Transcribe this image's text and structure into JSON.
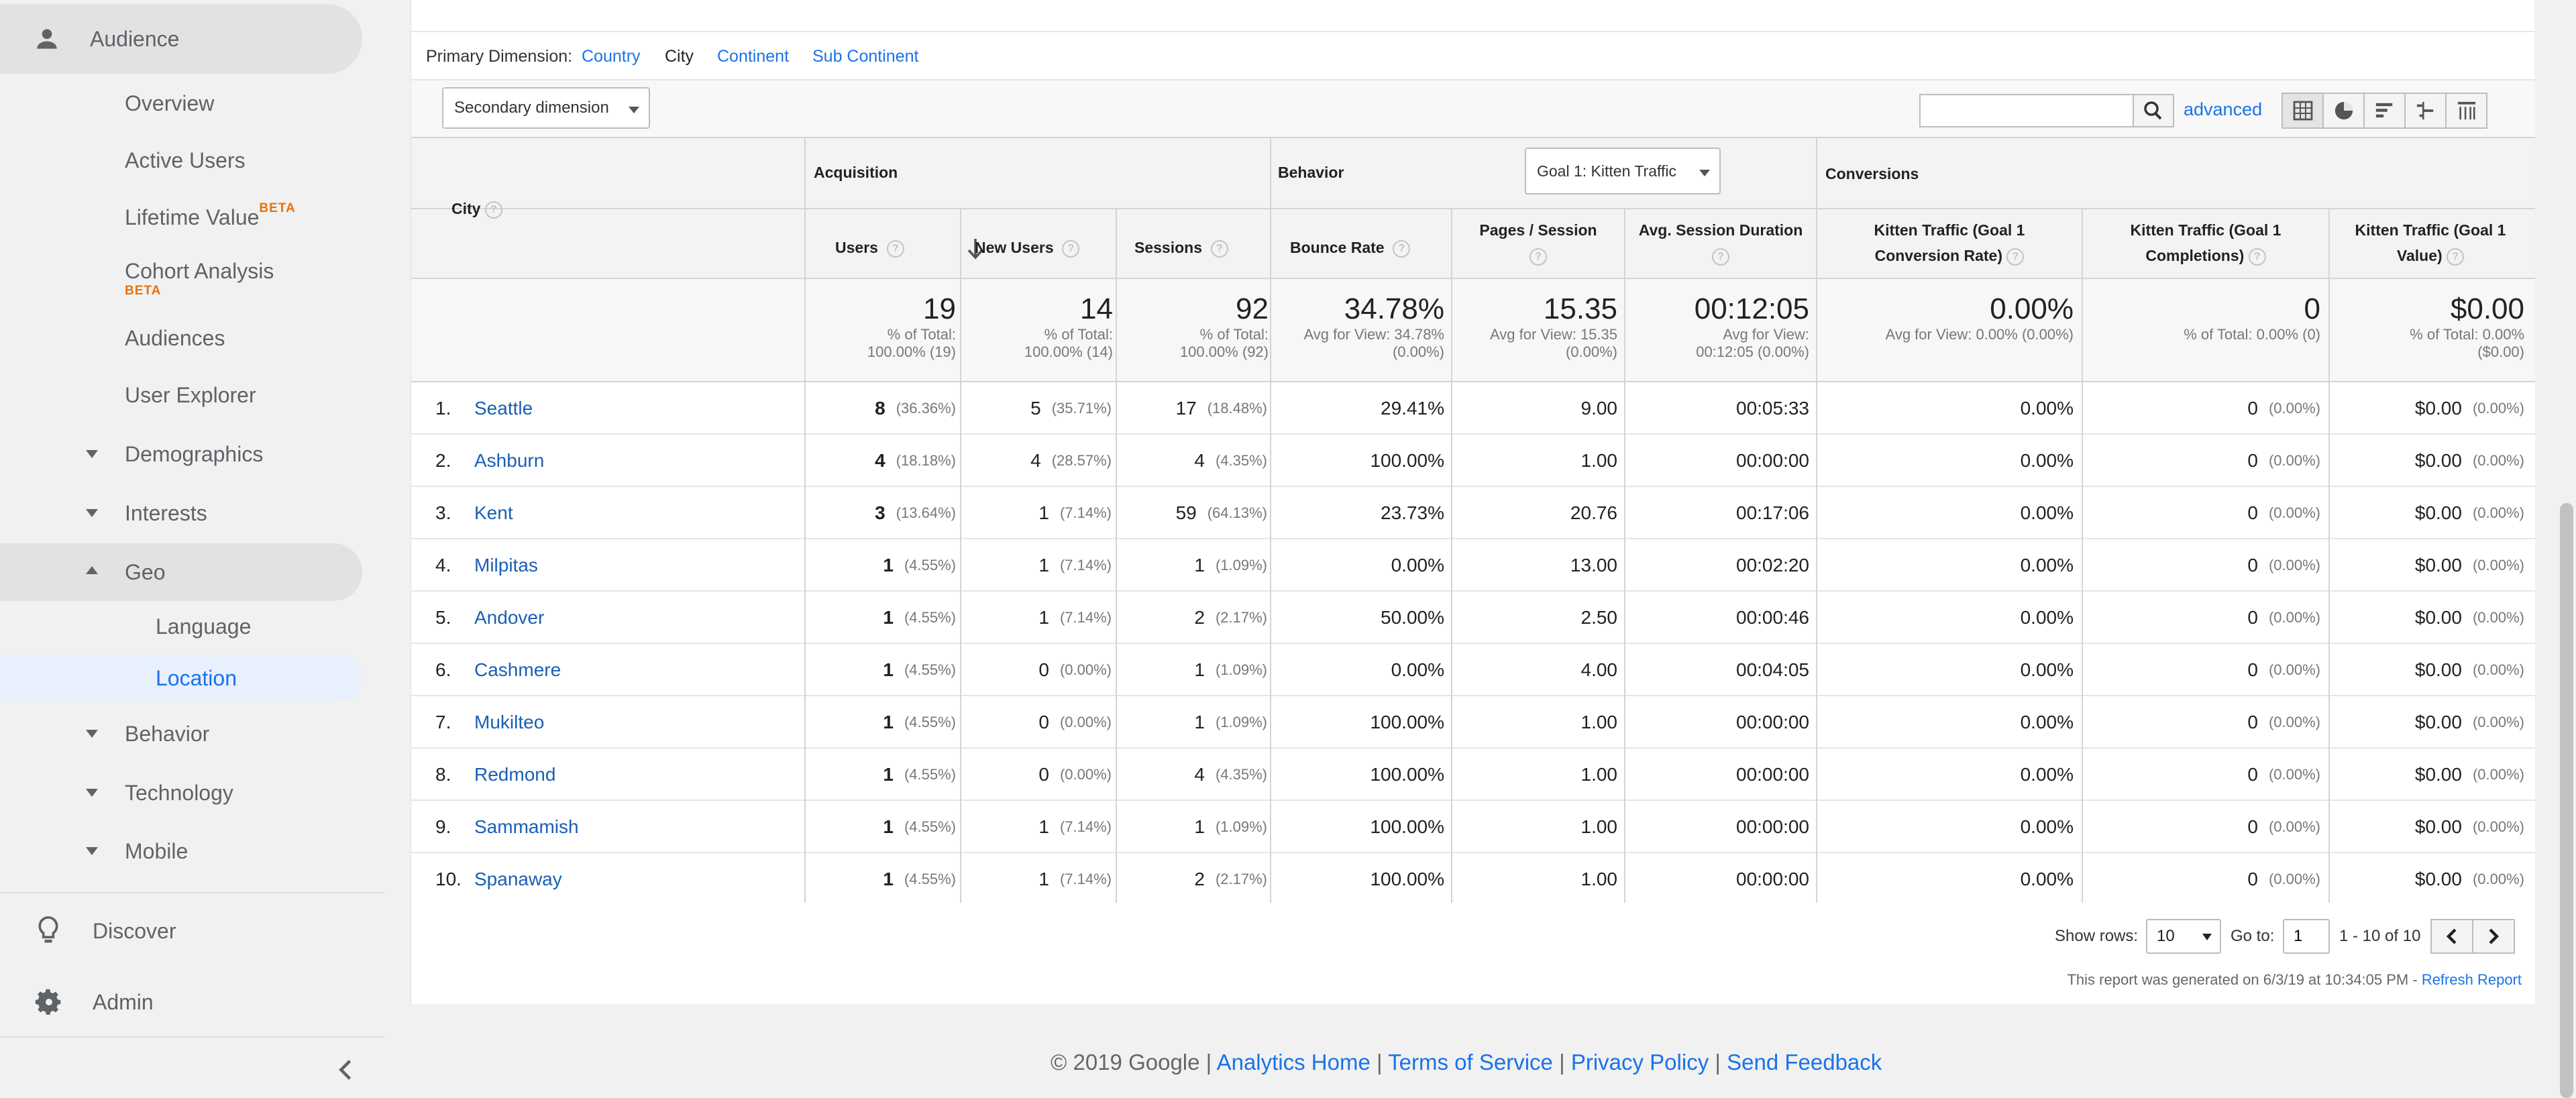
{
  "sidebar": {
    "audience": "Audience",
    "items": [
      {
        "label": "Overview"
      },
      {
        "label": "Active Users"
      },
      {
        "label": "Lifetime Value",
        "badge": "BETA"
      },
      {
        "label": "Cohort Analysis",
        "badge": "BETA"
      },
      {
        "label": "Audiences"
      },
      {
        "label": "User Explorer"
      }
    ],
    "demographics": "Demographics",
    "interests": "Interests",
    "geo": "Geo",
    "language": "Language",
    "location": "Location",
    "behavior": "Behavior",
    "technology": "Technology",
    "mobile": "Mobile",
    "discover": "Discover",
    "admin": "Admin"
  },
  "primary_dimension": {
    "label": "Primary Dimension:",
    "options": [
      "Country",
      "City",
      "Continent",
      "Sub Continent"
    ],
    "selected": "City"
  },
  "toolbar": {
    "secondary_dimension": "Secondary dimension",
    "search_value": "",
    "advanced": "advanced"
  },
  "table": {
    "dimension_header": "City",
    "groups": {
      "acquisition": "Acquisition",
      "behavior": "Behavior",
      "conversions": "Conversions"
    },
    "goal_select": "Goal 1: Kitten Traffic",
    "columns": {
      "users": "Users",
      "new_users": "New Users",
      "sessions": "Sessions",
      "bounce_rate": "Bounce Rate",
      "pages_session": "Pages / Session",
      "avg_duration": "Avg. Session Duration",
      "conv_rate_1": "Kitten Traffic (Goal 1",
      "conv_rate_2": "Conversion Rate)",
      "completions_1": "Kitten Traffic (Goal 1",
      "completions_2": "Completions)",
      "value_1": "Kitten Traffic (Goal 1",
      "value_2": "Value)"
    },
    "totals": {
      "users": {
        "big": "19",
        "l1": "% of Total:",
        "l2": "100.00% (19)"
      },
      "new_users": {
        "big": "14",
        "l1": "% of Total:",
        "l2": "100.00% (14)"
      },
      "sessions": {
        "big": "92",
        "l1": "% of Total:",
        "l2": "100.00% (92)"
      },
      "bounce_rate": {
        "big": "34.78%",
        "l1": "Avg for View: 34.78%",
        "l2": "(0.00%)"
      },
      "pages_session": {
        "big": "15.35",
        "l1": "Avg for View: 15.35",
        "l2": "(0.00%)"
      },
      "avg_duration": {
        "big": "00:12:05",
        "l1": "Avg for View:",
        "l2": "00:12:05 (0.00%)"
      },
      "conv_rate": {
        "big": "0.00%",
        "l1": "Avg for View: 0.00% (0.00%)",
        "l2": ""
      },
      "completions": {
        "big": "0",
        "l1": "% of Total: 0.00% (0)",
        "l2": ""
      },
      "value": {
        "big": "$0.00",
        "l1": "% of Total: 0.00%",
        "l2": "($0.00)"
      }
    },
    "rows": [
      {
        "n": "1.",
        "city": "Seattle",
        "users": "8",
        "users_pct": "(36.36%)",
        "new_users": "5",
        "new_users_pct": "(35.71%)",
        "sessions": "17",
        "sessions_pct": "(18.48%)",
        "bounce": "29.41%",
        "pps": "9.00",
        "dur": "00:05:33",
        "conv": "0.00%",
        "comp": "0",
        "comp_pct": "(0.00%)",
        "val": "$0.00",
        "val_pct": "(0.00%)"
      },
      {
        "n": "2.",
        "city": "Ashburn",
        "users": "4",
        "users_pct": "(18.18%)",
        "new_users": "4",
        "new_users_pct": "(28.57%)",
        "sessions": "4",
        "sessions_pct": "(4.35%)",
        "bounce": "100.00%",
        "pps": "1.00",
        "dur": "00:00:00",
        "conv": "0.00%",
        "comp": "0",
        "comp_pct": "(0.00%)",
        "val": "$0.00",
        "val_pct": "(0.00%)"
      },
      {
        "n": "3.",
        "city": "Kent",
        "users": "3",
        "users_pct": "(13.64%)",
        "new_users": "1",
        "new_users_pct": "(7.14%)",
        "sessions": "59",
        "sessions_pct": "(64.13%)",
        "bounce": "23.73%",
        "pps": "20.76",
        "dur": "00:17:06",
        "conv": "0.00%",
        "comp": "0",
        "comp_pct": "(0.00%)",
        "val": "$0.00",
        "val_pct": "(0.00%)"
      },
      {
        "n": "4.",
        "city": "Milpitas",
        "users": "1",
        "users_pct": "(4.55%)",
        "new_users": "1",
        "new_users_pct": "(7.14%)",
        "sessions": "1",
        "sessions_pct": "(1.09%)",
        "bounce": "0.00%",
        "pps": "13.00",
        "dur": "00:02:20",
        "conv": "0.00%",
        "comp": "0",
        "comp_pct": "(0.00%)",
        "val": "$0.00",
        "val_pct": "(0.00%)"
      },
      {
        "n": "5.",
        "city": "Andover",
        "users": "1",
        "users_pct": "(4.55%)",
        "new_users": "1",
        "new_users_pct": "(7.14%)",
        "sessions": "2",
        "sessions_pct": "(2.17%)",
        "bounce": "50.00%",
        "pps": "2.50",
        "dur": "00:00:46",
        "conv": "0.00%",
        "comp": "0",
        "comp_pct": "(0.00%)",
        "val": "$0.00",
        "val_pct": "(0.00%)"
      },
      {
        "n": "6.",
        "city": "Cashmere",
        "users": "1",
        "users_pct": "(4.55%)",
        "new_users": "0",
        "new_users_pct": "(0.00%)",
        "sessions": "1",
        "sessions_pct": "(1.09%)",
        "bounce": "0.00%",
        "pps": "4.00",
        "dur": "00:04:05",
        "conv": "0.00%",
        "comp": "0",
        "comp_pct": "(0.00%)",
        "val": "$0.00",
        "val_pct": "(0.00%)"
      },
      {
        "n": "7.",
        "city": "Mukilteo",
        "users": "1",
        "users_pct": "(4.55%)",
        "new_users": "0",
        "new_users_pct": "(0.00%)",
        "sessions": "1",
        "sessions_pct": "(1.09%)",
        "bounce": "100.00%",
        "pps": "1.00",
        "dur": "00:00:00",
        "conv": "0.00%",
        "comp": "0",
        "comp_pct": "(0.00%)",
        "val": "$0.00",
        "val_pct": "(0.00%)"
      },
      {
        "n": "8.",
        "city": "Redmond",
        "users": "1",
        "users_pct": "(4.55%)",
        "new_users": "0",
        "new_users_pct": "(0.00%)",
        "sessions": "4",
        "sessions_pct": "(4.35%)",
        "bounce": "100.00%",
        "pps": "1.00",
        "dur": "00:00:00",
        "conv": "0.00%",
        "comp": "0",
        "comp_pct": "(0.00%)",
        "val": "$0.00",
        "val_pct": "(0.00%)"
      },
      {
        "n": "9.",
        "city": "Sammamish",
        "users": "1",
        "users_pct": "(4.55%)",
        "new_users": "1",
        "new_users_pct": "(7.14%)",
        "sessions": "1",
        "sessions_pct": "(1.09%)",
        "bounce": "100.00%",
        "pps": "1.00",
        "dur": "00:00:00",
        "conv": "0.00%",
        "comp": "0",
        "comp_pct": "(0.00%)",
        "val": "$0.00",
        "val_pct": "(0.00%)"
      },
      {
        "n": "10.",
        "city": "Spanaway",
        "users": "1",
        "users_pct": "(4.55%)",
        "new_users": "1",
        "new_users_pct": "(7.14%)",
        "sessions": "2",
        "sessions_pct": "(2.17%)",
        "bounce": "100.00%",
        "pps": "1.00",
        "dur": "00:00:00",
        "conv": "0.00%",
        "comp": "0",
        "comp_pct": "(0.00%)",
        "val": "$0.00",
        "val_pct": "(0.00%)"
      }
    ]
  },
  "pagination": {
    "show_rows_label": "Show rows:",
    "show_rows_value": "10",
    "goto_label": "Go to:",
    "goto_value": "1",
    "range": "1 - 10 of 10"
  },
  "report": {
    "generated": "This report was generated on 6/3/19 at 10:34:05 PM -",
    "refresh": "Refresh Report"
  },
  "footer": {
    "copyright": "© 2019 Google |",
    "analytics_home": "Analytics Home",
    "terms": "Terms of Service",
    "privacy": "Privacy Policy",
    "feedback": "Send Feedback",
    "sep": "|"
  },
  "colors": {
    "link": "#1a73e8",
    "selected_bg": "#e8f0fe",
    "beta": "#e8710a"
  }
}
